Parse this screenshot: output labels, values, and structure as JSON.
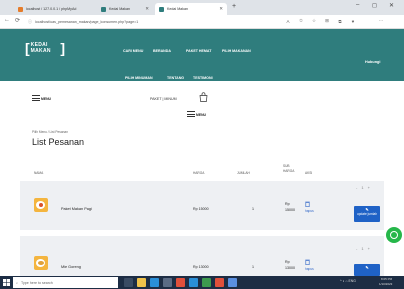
{
  "browser": {
    "tabs": [
      {
        "label": "localhost / 127.0.0.1 / phpMyAd",
        "favicon_color": "#e57c2b"
      },
      {
        "label": "Kedai Makan",
        "favicon_color": "#2f7d7d"
      },
      {
        "label": "Kedai Makan",
        "favicon_color": "#2f7d7d"
      }
    ],
    "new_tab": "+",
    "window_controls": [
      "–",
      "◻",
      "✕"
    ],
    "url": "localhost/uas_pemesanan_makan/page_konsumen.php?page=1",
    "extensions": [
      "A",
      "✩",
      "☆",
      "⊞",
      "⧉",
      "♥",
      "⋯"
    ]
  },
  "site": {
    "logo": "KEDAI MAKAN",
    "nav_row1": [
      "CARI MENU",
      "BERANDA",
      "PAKET HEMAT",
      "PILIH MAKANAN"
    ],
    "nav_row2": [
      "PILIH MINUMAN",
      "TENTANG",
      "TESTIMONI"
    ],
    "contact": "Hubungi",
    "menu_left_label": "MENU",
    "filter_text": "PAKET  |  MINUM",
    "menu_mid_label": "MENU"
  },
  "page": {
    "breadcrumb": "Pilih Menu  /  List Pesanan",
    "title": "List Pesanan",
    "columns": {
      "nama": "NAMA",
      "harga": "HARGA",
      "jumlah": "JUMLAH",
      "sub_harga": "SUB HARGA",
      "aksi": "AKSI"
    },
    "rows": [
      {
        "name": "Paket Makan Pagi",
        "price": "Rp 15000",
        "qty": "1",
        "subtotal_prefix": "Rp",
        "subtotal_value": "15000",
        "delete_label": "hapus",
        "stepper_minus": "-",
        "stepper_value": "1",
        "stepper_plus": "+",
        "update_label": "update jumlah"
      },
      {
        "name": "Mie Goreng",
        "price": "Rp 13000",
        "qty": "1",
        "subtotal_prefix": "Rp",
        "subtotal_value": "13000",
        "delete_label": "hapus",
        "stepper_minus": "-",
        "stepper_value": "1",
        "stepper_plus": "+",
        "update_label": "update jumlah"
      }
    ]
  },
  "taskbar": {
    "search_placeholder": "Type here to search",
    "tray_text": "^  ◖  ⌂  ENG",
    "clock_time": "8:05 PM",
    "clock_date": "1/10/2023"
  },
  "colors": {
    "header": "#2f7d7d",
    "update_button": "#1f62c6",
    "whatsapp": "#26b74a"
  }
}
